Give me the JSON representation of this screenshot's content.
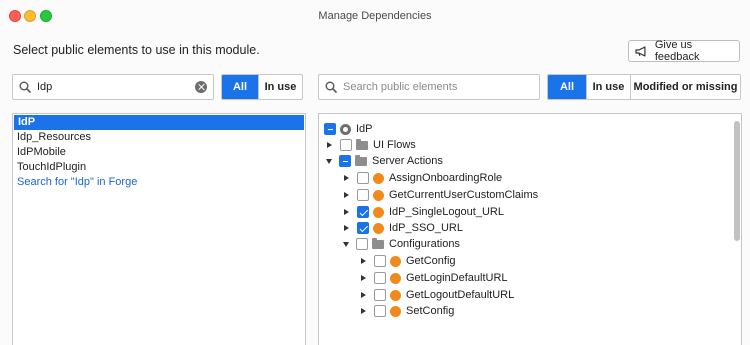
{
  "window": {
    "title": "Manage Dependencies"
  },
  "header": {
    "instruction": "Select public elements to use in this module.",
    "feedback_label": "Give us feedback"
  },
  "left": {
    "search": {
      "value": "Idp",
      "placeholder": ""
    },
    "filters": [
      "All",
      "In use"
    ],
    "active_filter": "All",
    "libraries": [
      {
        "label": "IdP",
        "selected": true
      },
      {
        "label": "Idp_Resources"
      },
      {
        "label": "IdPMobile"
      },
      {
        "label": "TouchIdPlugin"
      },
      {
        "label": "Search for \"Idp\" in Forge",
        "link": true
      }
    ]
  },
  "right": {
    "search": {
      "value": "",
      "placeholder": "Search public elements"
    },
    "filters": [
      "All",
      "In use",
      "Modified or missing"
    ],
    "active_filter": "All",
    "tree": [
      {
        "label": "IdP",
        "icon": "module-icon",
        "check": "mixed",
        "arrow": "none",
        "level": 0
      },
      {
        "label": "UI Flows",
        "icon": "folder-icon",
        "check": "unchecked",
        "arrow": "right",
        "level": 1
      },
      {
        "label": "Server Actions",
        "icon": "folder-icon",
        "check": "mixed",
        "arrow": "down",
        "level": 1
      },
      {
        "label": "AssignOnboardingRole",
        "icon": "server-action-icon",
        "check": "unchecked",
        "arrow": "right",
        "level": 2
      },
      {
        "label": "GetCurrentUserCustomClaims",
        "icon": "server-action-icon",
        "check": "unchecked",
        "arrow": "right",
        "level": 2
      },
      {
        "label": "IdP_SingleLogout_URL",
        "icon": "server-action-icon",
        "check": "checked",
        "arrow": "right",
        "level": 2
      },
      {
        "label": "IdP_SSO_URL",
        "icon": "server-action-icon",
        "check": "checked",
        "arrow": "right",
        "level": 2
      },
      {
        "label": "Configurations",
        "icon": "folder-icon",
        "check": "unchecked",
        "arrow": "down",
        "level": 2
      },
      {
        "label": "GetConfig",
        "icon": "server-action-icon",
        "check": "unchecked",
        "arrow": "right",
        "level": 3
      },
      {
        "label": "GetLoginDefaultURL",
        "icon": "server-action-icon",
        "check": "unchecked",
        "arrow": "right",
        "level": 3
      },
      {
        "label": "GetLogoutDefaultURL",
        "icon": "server-action-icon",
        "check": "unchecked",
        "arrow": "right",
        "level": 3
      },
      {
        "label": "SetConfig",
        "icon": "server-action-icon",
        "check": "unchecked",
        "arrow": "right",
        "level": 3
      }
    ]
  },
  "colors": {
    "accent": "#1a73e8",
    "server_action": "#f08a1c",
    "link": "#1a66cc"
  }
}
